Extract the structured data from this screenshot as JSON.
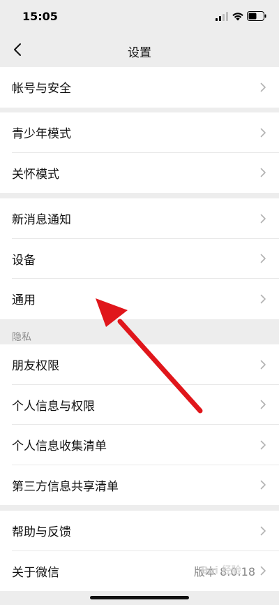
{
  "status_bar": {
    "time": "15:05",
    "icons": [
      "signal-icon",
      "wifi-icon",
      "battery-icon"
    ]
  },
  "nav": {
    "title": "设置",
    "back_icon": "chevron-left-icon"
  },
  "groups": [
    {
      "items": [
        {
          "label": "帐号与安全"
        }
      ]
    },
    {
      "items": [
        {
          "label": "青少年模式"
        },
        {
          "label": "关怀模式"
        }
      ]
    },
    {
      "items": [
        {
          "label": "新消息通知"
        },
        {
          "label": "设备"
        },
        {
          "label": "通用"
        }
      ]
    },
    {
      "header": "隐私",
      "items": [
        {
          "label": "朋友权限"
        },
        {
          "label": "个人信息与权限"
        },
        {
          "label": "个人信息收集清单"
        },
        {
          "label": "第三方信息共享清单"
        }
      ]
    },
    {
      "items": [
        {
          "label": "帮助与反馈"
        },
        {
          "label": "关于微信",
          "value": "版本 8.0.18"
        }
      ]
    }
  ],
  "annotation": {
    "type": "red-arrow",
    "color": "#e0161b",
    "points_to": "通用"
  },
  "watermark": "Bai 经验",
  "colors": {
    "background": "#ededed",
    "card": "#ffffff",
    "text": "#111111",
    "secondary": "#8a8a8a"
  }
}
